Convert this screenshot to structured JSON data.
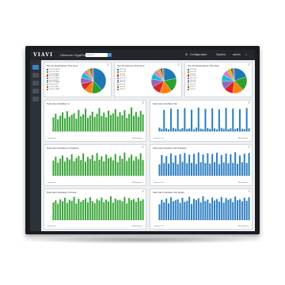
{
  "topbar": {
    "logo": "VIAVI",
    "app_name": "Observer GigaFlow",
    "search_placeholder": "Search",
    "configuration_label": "Configuration",
    "system_label": "System",
    "admin_label": "admin"
  },
  "pie_cards": [
    {
      "title": "Top 10 Applications This Hour",
      "legend": [
        "10.0.0.45 HTTP",
        "10.0.2.11 SSL",
        "10.1.4.2 DNS",
        "10.2.0.8 SMB",
        "10.0.1.23 RDP",
        "10.0.3.6 NTP",
        "10.3.1.9 SNMP",
        "10.0.0.2 FTP",
        "10.4.2.1 SSH",
        "10.0.5.7 LDAP"
      ]
    },
    {
      "title": "Top 10 Sources This Hour",
      "legend": [
        "10.0.0.45",
        "10.0.2.11",
        "10.1.4.2",
        "10.2.0.8",
        "10.0.1.23",
        "10.0.3.6",
        "10.3.1.9",
        "10.0.0.2",
        "10.4.2.1",
        "10.0.5.7"
      ]
    },
    {
      "title": "Top 10 Destinations This Hour",
      "legend": [
        "10.0.0.45",
        "10.0.2.11",
        "10.1.4.2",
        "10.2.0.8",
        "10.0.1.23",
        "10.0.3.6",
        "10.3.1.9",
        "10.0.0.2",
        "10.4.2.1",
        "10.0.5.7"
      ]
    }
  ],
  "bar_cards": [
    {
      "title": "Summary Interface In",
      "foot": "Interface In",
      "foot_right": "All Interfaces"
    },
    {
      "title": "Summary Interface Out",
      "foot": "Interface Out",
      "foot_right": "All Interfaces"
    },
    {
      "title": "Summary Interface In Packets",
      "foot": "Interface In",
      "foot_right": "All Interfaces"
    },
    {
      "title": "Summary Interface Out Packets",
      "foot": "Interface Out",
      "foot_right": "All Interfaces"
    },
    {
      "title": "Summary Interface In Flows",
      "foot": "Interface In",
      "foot_right": "All Interfaces"
    },
    {
      "title": "Summary Interface Out Flows",
      "foot": "Interface Out",
      "foot_right": "All Interfaces"
    }
  ],
  "colors": {
    "green": "#3aa63a",
    "blue": "#2f7fc1",
    "accent": "#3b82c4",
    "sidebar": "#2d3138",
    "pie": [
      "#1f77b4",
      "#2ca02c",
      "#ff7f0e",
      "#d62728",
      "#9467bd",
      "#17becf",
      "#e377c2",
      "#bcbd22",
      "#8c564b",
      "#7f7f7f"
    ]
  },
  "chart_data": [
    {
      "type": "pie",
      "values": [
        38,
        14,
        10,
        9,
        8,
        7,
        5,
        4,
        3,
        2
      ]
    },
    {
      "type": "pie",
      "values": [
        22,
        18,
        15,
        12,
        10,
        8,
        6,
        4,
        3,
        2
      ]
    },
    {
      "type": "pie",
      "values": [
        20,
        18,
        14,
        12,
        10,
        9,
        7,
        5,
        3,
        2
      ]
    },
    {
      "type": "bar",
      "values": [
        55,
        70,
        48,
        62,
        75,
        52,
        80,
        58,
        66,
        72,
        50,
        85,
        60,
        68,
        90,
        54,
        63,
        78,
        57,
        70,
        92,
        61,
        74,
        56,
        82,
        65,
        71,
        88,
        59,
        76,
        64,
        84,
        53,
        69,
        95,
        62,
        77,
        58,
        81,
        67
      ]
    },
    {
      "type": "bar",
      "values": [
        15,
        10,
        85,
        12,
        8,
        90,
        14,
        11,
        88,
        9,
        13,
        92,
        10,
        12,
        86,
        8,
        15,
        94,
        11,
        9,
        89,
        13,
        10,
        91,
        12,
        8,
        87,
        14,
        11,
        93,
        9,
        12,
        90,
        10,
        13,
        88,
        11,
        9,
        92,
        12
      ]
    },
    {
      "type": "bar",
      "values": [
        60,
        75,
        52,
        68,
        80,
        56,
        72,
        64,
        85,
        58,
        70,
        78,
        62,
        88,
        55,
        74,
        66,
        82,
        59,
        90,
        63,
        77,
        57,
        84,
        69,
        73,
        61,
        86,
        54,
        79,
        67,
        92,
        58,
        71,
        83,
        60,
        76,
        65,
        89,
        62
      ]
    },
    {
      "type": "bar",
      "values": [
        45,
        82,
        50,
        78,
        48,
        88,
        52,
        80,
        46,
        85,
        55,
        90,
        49,
        83,
        51,
        87,
        47,
        92,
        53,
        84,
        50,
        89,
        48,
        86,
        54,
        91,
        46,
        82,
        52,
        88,
        49,
        85,
        51,
        93,
        47,
        80,
        53,
        87,
        50,
        90
      ]
    },
    {
      "type": "bar",
      "values": [
        70,
        78,
        65,
        82,
        74,
        88,
        68,
        80,
        76,
        92,
        66,
        84,
        72,
        79,
        86,
        70,
        90,
        75,
        67,
        83,
        77,
        89,
        71,
        81,
        73,
        94,
        69,
        85,
        78,
        80,
        74,
        91,
        66,
        87,
        79,
        83,
        72,
        88,
        76,
        82
      ]
    },
    {
      "type": "bar",
      "values": [
        62,
        80,
        70,
        85,
        66,
        90,
        74,
        78,
        82,
        68,
        88,
        72,
        76,
        92,
        64,
        84,
        79,
        86,
        70,
        94,
        75,
        81,
        67,
        89,
        77,
        83,
        73,
        91,
        69,
        87,
        80,
        85,
        71,
        93,
        78,
        82,
        74,
        88,
        76,
        90
      ]
    }
  ]
}
